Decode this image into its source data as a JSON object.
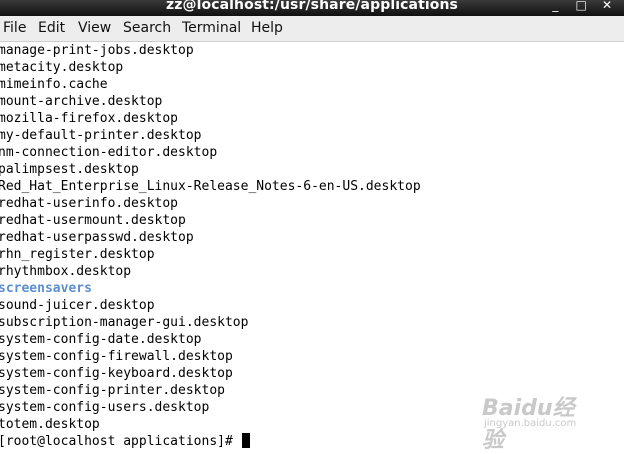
{
  "window": {
    "title": "zz@localhost:/usr/share/applications",
    "controls": [
      "_",
      "□",
      "✕"
    ]
  },
  "menu": [
    "File",
    "Edit",
    "View",
    "Search",
    "Terminal",
    "Help"
  ],
  "terminal": {
    "lines": [
      {
        "text": "manage-print-jobs.desktop",
        "type": "file"
      },
      {
        "text": "metacity.desktop",
        "type": "file"
      },
      {
        "text": "mimeinfo.cache",
        "type": "file"
      },
      {
        "text": "mount-archive.desktop",
        "type": "file"
      },
      {
        "text": "mozilla-firefox.desktop",
        "type": "file"
      },
      {
        "text": "my-default-printer.desktop",
        "type": "file"
      },
      {
        "text": "nm-connection-editor.desktop",
        "type": "file"
      },
      {
        "text": "palimpsest.desktop",
        "type": "file"
      },
      {
        "text": "Red_Hat_Enterprise_Linux-Release_Notes-6-en-US.desktop",
        "type": "file"
      },
      {
        "text": "redhat-userinfo.desktop",
        "type": "file"
      },
      {
        "text": "redhat-usermount.desktop",
        "type": "file"
      },
      {
        "text": "redhat-userpasswd.desktop",
        "type": "file"
      },
      {
        "text": "rhn_register.desktop",
        "type": "file"
      },
      {
        "text": "rhythmbox.desktop",
        "type": "file"
      },
      {
        "text": "screensavers",
        "type": "dir"
      },
      {
        "text": "sound-juicer.desktop",
        "type": "file"
      },
      {
        "text": "subscription-manager-gui.desktop",
        "type": "file"
      },
      {
        "text": "system-config-date.desktop",
        "type": "file"
      },
      {
        "text": "system-config-firewall.desktop",
        "type": "file"
      },
      {
        "text": "system-config-keyboard.desktop",
        "type": "file"
      },
      {
        "text": "system-config-printer.desktop",
        "type": "file"
      },
      {
        "text": "system-config-users.desktop",
        "type": "file"
      },
      {
        "text": "totem.desktop",
        "type": "file"
      }
    ],
    "prompt": "[root@localhost applications]# "
  },
  "watermark": {
    "logo": "Baidu经验",
    "url": "jingyan.baidu.com"
  },
  "colors": {
    "directory": "#5b8fd0",
    "titlebar": "#1a1a1a",
    "menubar": "#ededed"
  }
}
